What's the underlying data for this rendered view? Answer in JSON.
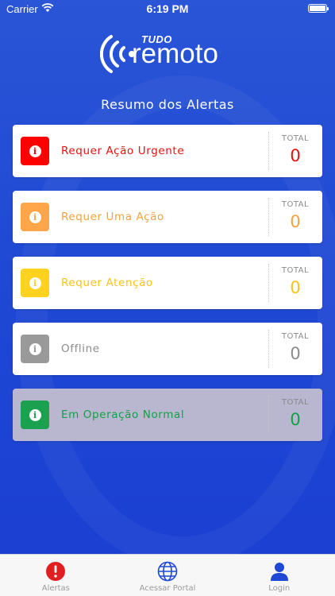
{
  "status_bar": {
    "carrier": "Carrier",
    "time": "6:19 PM"
  },
  "logo": {
    "small_text": "TUDO",
    "big_text": "remoto"
  },
  "title": "Resumo dos Alertas",
  "total_label": "TOTAL",
  "cards": [
    {
      "label": "Requer Ação Urgente",
      "total": "0",
      "color": "#e81010",
      "icon_bg": "#ff0000"
    },
    {
      "label": "Requer Uma Ação",
      "total": "0",
      "color": "#f5a142",
      "icon_bg": "#ffa64a"
    },
    {
      "label": "Requer Atenção",
      "total": "0",
      "color": "#f7c417",
      "icon_bg": "#ffd21f"
    },
    {
      "label": "Offline",
      "total": "0",
      "color": "#8c8c8c",
      "icon_bg": "#999999"
    },
    {
      "label": "Em Operação Normal",
      "total": "0",
      "color": "#10a247",
      "icon_bg": "#1aa04f"
    }
  ],
  "tabs": [
    {
      "label": "Alertas",
      "icon": "alert-circle-icon",
      "active": true
    },
    {
      "label": "Acessar Portal",
      "icon": "globe-icon",
      "active": false
    },
    {
      "label": "Login",
      "icon": "user-icon",
      "active": false
    }
  ]
}
